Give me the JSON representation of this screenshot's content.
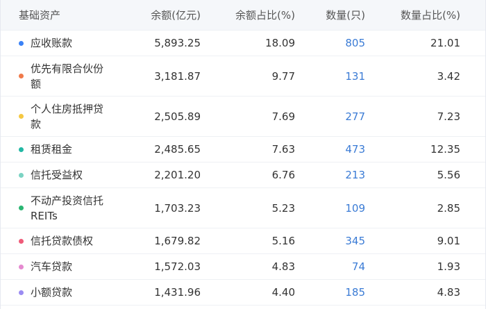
{
  "header": {
    "col1": "基础资产",
    "col2": "余额(亿元)",
    "col3": "余额占比(%)",
    "col4": "数量(只)",
    "col5": "数量占比(%)"
  },
  "rows": [
    {
      "name": "应收账款",
      "amount": "5,893.25",
      "amount_pct": "18.09",
      "count": "805",
      "count_pct": "21.01",
      "color": "#3b82f6"
    },
    {
      "name": "优先有限合伙份额",
      "amount": "3,181.87",
      "amount_pct": "9.77",
      "count": "131",
      "count_pct": "3.42",
      "color": "#f07a4a"
    },
    {
      "name": "个人住房抵押贷款",
      "amount": "2,505.89",
      "amount_pct": "7.69",
      "count": "277",
      "count_pct": "7.23",
      "color": "#f5c842"
    },
    {
      "name": "租赁租金",
      "amount": "2,485.65",
      "amount_pct": "7.63",
      "count": "473",
      "count_pct": "12.35",
      "color": "#22b8a4"
    },
    {
      "name": "信托受益权",
      "amount": "2,201.20",
      "amount_pct": "6.76",
      "count": "213",
      "count_pct": "5.56",
      "color": "#7bd3c3"
    },
    {
      "name": "不动产投资信托REITs",
      "amount": "1,703.23",
      "amount_pct": "5.23",
      "count": "109",
      "count_pct": "2.85",
      "color": "#2bb673"
    },
    {
      "name": "信托贷款债权",
      "amount": "1,679.82",
      "amount_pct": "5.16",
      "count": "345",
      "count_pct": "9.01",
      "color": "#ef5b79"
    },
    {
      "name": "汽车贷款",
      "amount": "1,572.03",
      "amount_pct": "4.83",
      "count": "74",
      "count_pct": "1.93",
      "color": "#e58ad0"
    },
    {
      "name": "小额贷款",
      "amount": "1,431.96",
      "amount_pct": "4.40",
      "count": "185",
      "count_pct": "4.83",
      "color": "#9b8cf2"
    }
  ]
}
